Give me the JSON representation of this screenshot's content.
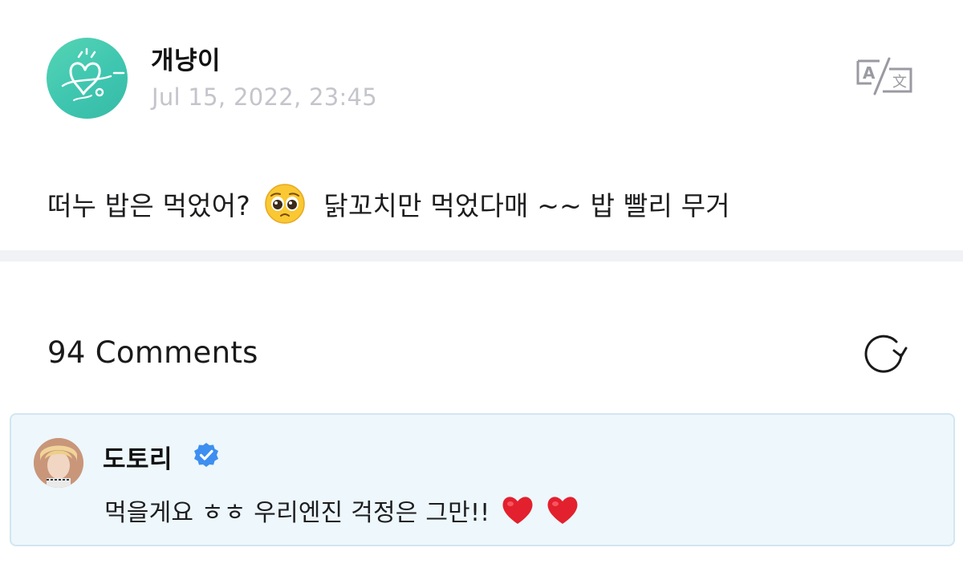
{
  "post": {
    "author_name": "개냥이",
    "date": "Jul 15, 2022, 23:45",
    "body_before_emoji": "떠누 밥은 먹었어?",
    "body_emoji": "pleading-face-emoji",
    "body_after_emoji": "닭꼬치만 먹었다매 ~~ 밥 빨리 무거",
    "translate_icon": "translate-icon",
    "avatar_color": "#46c9b0"
  },
  "comments": {
    "count_label": "94 Comments",
    "refresh_icon": "refresh-icon",
    "items": [
      {
        "author_name": "도토리",
        "verified": true,
        "verified_color": "#3d8ff0",
        "text": "먹을게요 ㅎㅎ 우리엔진 걱정은 그만!!",
        "trailing_emoji": [
          "red-heart-emoji",
          "red-heart-emoji"
        ],
        "card_color": "#edf7fc"
      }
    ]
  }
}
